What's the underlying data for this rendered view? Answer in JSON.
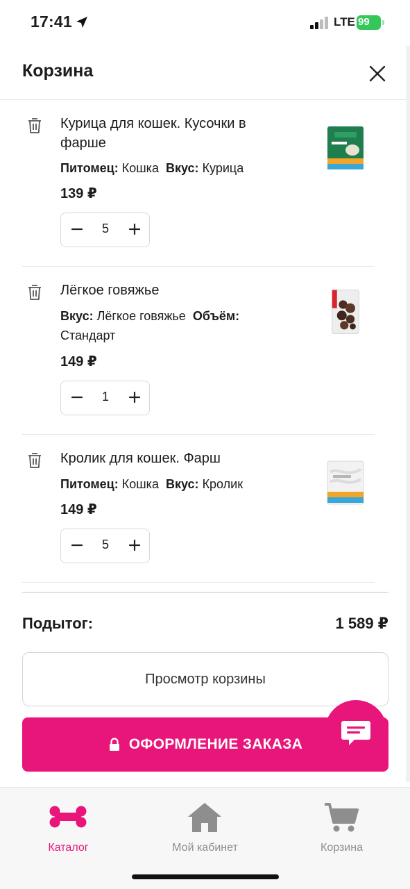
{
  "status_bar": {
    "time": "17:41",
    "network": "LTE",
    "battery": "99"
  },
  "header": {
    "title": "Корзина"
  },
  "items": [
    {
      "title": "Курица для кошек. Кусочки в фарше",
      "attrs": [
        {
          "label": "Питомец:",
          "value": "Кошка"
        },
        {
          "label": "Вкус:",
          "value": "Курица"
        }
      ],
      "price": "139 ₽",
      "qty": "5"
    },
    {
      "title": "Лёгкое говяжье",
      "attrs": [
        {
          "label": "Вкус:",
          "value": "Лёгкое говяжье"
        },
        {
          "label": "Объём:",
          "value": "Стандарт"
        }
      ],
      "price": "149 ₽",
      "qty": "1"
    },
    {
      "title": "Кролик для кошек. Фарш",
      "attrs": [
        {
          "label": "Питомец:",
          "value": "Кошка"
        },
        {
          "label": "Вкус:",
          "value": "Кролик"
        }
      ],
      "price": "149 ₽",
      "qty": "5"
    }
  ],
  "summary": {
    "subtotal_label": "Подытог:",
    "subtotal_value": "1 589 ₽",
    "view_cart": "Просмотр корзины",
    "checkout": "ОФОРМЛЕНИЕ ЗАКАЗА"
  },
  "tabs": [
    {
      "label": "Каталог",
      "icon": "bone-icon"
    },
    {
      "label": "Мой кабинет",
      "icon": "home-icon"
    },
    {
      "label": "Корзина",
      "icon": "cart-icon"
    }
  ],
  "colors": {
    "accent": "#e8157a",
    "battery": "#34c759",
    "muted": "#8e8e8e"
  }
}
